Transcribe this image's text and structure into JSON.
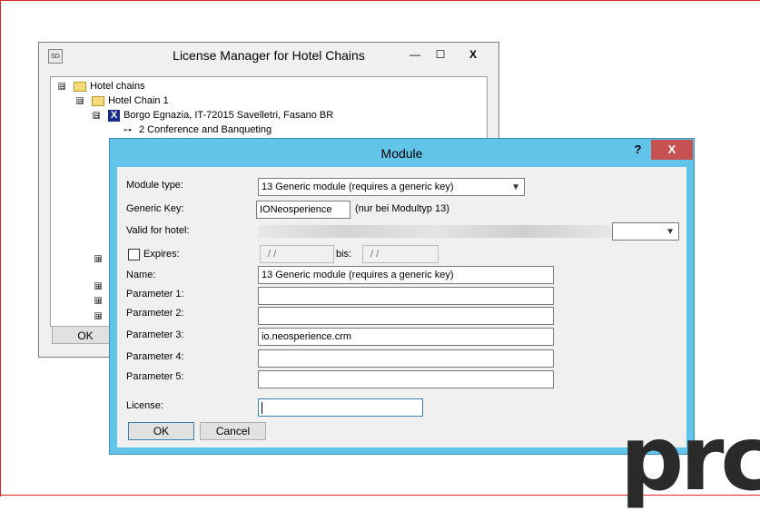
{
  "license_manager": {
    "title": "License Manager for Hotel Chains",
    "app_icon_text": "SD",
    "controls": {
      "minimize": "—",
      "maximize": "☐",
      "close": "X"
    },
    "tree": [
      {
        "label": "Hotel chains",
        "expander": "⊟"
      },
      {
        "label": "Hotel Chain 1",
        "expander": "⊟"
      },
      {
        "label": "Borgo Egnazia, IT-72015 Savelletri, Fasano BR",
        "expander": "⊟",
        "icon_text": "X"
      },
      {
        "label": "2 Conference and Banqueting"
      }
    ],
    "partial_expanders": [
      "⊞",
      "⊞",
      "⊞",
      "⊞",
      "⊞"
    ],
    "ok_label": "OK"
  },
  "module_dialog": {
    "title": "Module",
    "help_label": "?",
    "close_label": "X",
    "module_type_label": "Module type:",
    "module_type_value": "13 Generic module (requires a generic key)",
    "generic_key_label": "Generic Key:",
    "generic_key_value": "IONeosperience",
    "generic_key_hint": "(nur bei Modultyp 13)",
    "valid_for_hotel_label": "Valid for hotel:",
    "expires_label": "Expires:",
    "expires_from": "/  /",
    "bis_label": "bis:",
    "expires_to": "/  /",
    "name_label": "Name:",
    "name_value": "13 Generic module (requires a generic key)",
    "parameter1_label": "Parameter 1:",
    "parameter1_value": "",
    "parameter2_label": "Parameter 2:",
    "parameter2_value": "",
    "parameter3_label": "Parameter 3:",
    "parameter3_value": "io.neosperience.crm",
    "parameter4_label": "Parameter 4:",
    "parameter4_value": "",
    "parameter5_label": "Parameter 5:",
    "parameter5_value": "",
    "license_label": "License:",
    "license_value": "",
    "ok_label": "OK",
    "cancel_label": "Cancel"
  },
  "logo_fragment": "prc",
  "colors": {
    "dialog_border": "#63c4ea",
    "close_button": "#c75050",
    "frame_accent": "#d8262e"
  }
}
